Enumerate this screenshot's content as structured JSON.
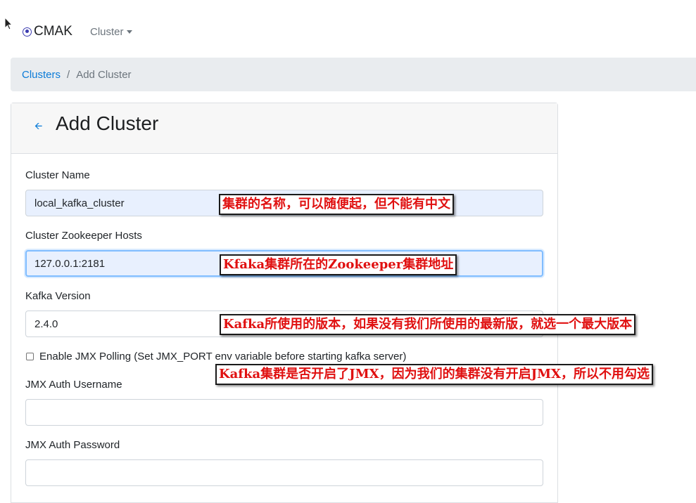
{
  "nav": {
    "brand": "CMAK",
    "cluster_menu": "Cluster"
  },
  "breadcrumb": {
    "clusters": "Clusters",
    "separator": "/",
    "current": "Add Cluster"
  },
  "card": {
    "back_icon": "left-arrow-icon",
    "title": "Add Cluster"
  },
  "form": {
    "cluster_name_label": "Cluster Name",
    "cluster_name_value": "local_kafka_cluster",
    "zk_hosts_label": "Cluster Zookeeper Hosts",
    "zk_hosts_value": "127.0.0.1:2181",
    "kafka_version_label": "Kafka Version",
    "kafka_version_value": "2.4.0",
    "jmx_polling_label": "Enable JMX Polling (Set JMX_PORT env variable before starting kafka server)",
    "jmx_polling_checked": false,
    "jmx_user_label": "JMX Auth Username",
    "jmx_user_value": "",
    "jmx_pass_label": "JMX Auth Password",
    "jmx_pass_value": ""
  },
  "annotations": {
    "cluster_name_note": "集群的名称，可以随便起，但不能有中文",
    "zk_hosts_note": "Kfaka集群所在的Zookeeper集群地址",
    "kafka_version_note": "Kafka所使用的版本，如果没有我们所使用的最新版，就选一个最大版本",
    "jmx_note": "Kafka集群是否开启了JMX，因为我们的集群没有开启JMX，所以不用勾选"
  },
  "colors": {
    "link": "#0a7bd8",
    "note_text": "#e01010",
    "breadcrumb_bg": "#e9ecef",
    "autofill_bg": "#e8f0fe"
  }
}
